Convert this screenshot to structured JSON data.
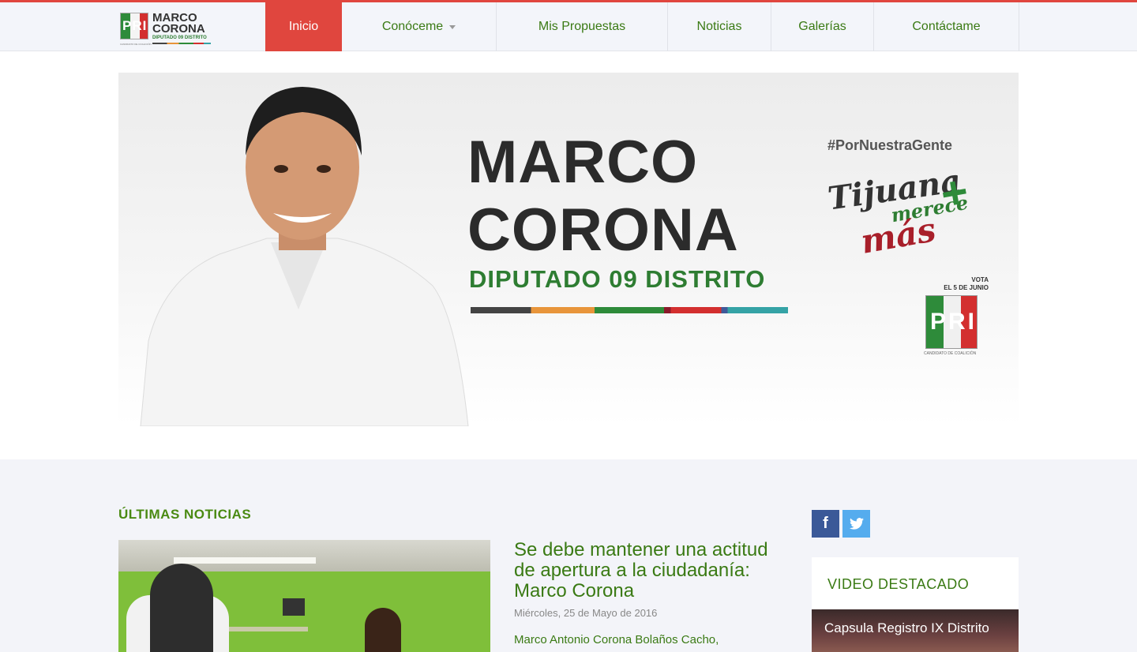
{
  "brand": {
    "logo_letters": "PRI",
    "name_line1": "MARCO",
    "name_line2": "CORONA",
    "subtitle": "DIPUTADO 09 DISTRITO",
    "tiny_caption": "CANDIDATO DE COALICIÓN"
  },
  "nav": {
    "items": [
      {
        "label": "Inicio",
        "active": true
      },
      {
        "label": "Conóceme",
        "has_dropdown": true
      },
      {
        "label": "Mis Propuestas"
      },
      {
        "label": "Noticias"
      },
      {
        "label": "Galerías"
      },
      {
        "label": "Contáctame"
      }
    ]
  },
  "hero": {
    "title_line1": "MARCO",
    "title_line2": "CORONA",
    "subtitle": "DIPUTADO 09 DISTRITO",
    "hashtag": "#PorNuestraGente",
    "slogan_word1": "Tijuana",
    "slogan_word2": "merece",
    "slogan_word3": "más",
    "slogan_plus": "+",
    "vote_line1": "VOTA",
    "vote_line2": "EL 5 DE JUNIO",
    "party_letters": "PRI",
    "party_caption": "CANDIDATO DE COALICIÓN"
  },
  "news": {
    "section_title": "ÚLTIMAS NOTICIAS",
    "title": "Se debe mantener una actitud de apertura a la ciudadanía: Marco Corona",
    "date": "Miércoles, 25 de Mayo de 2016",
    "excerpt": "Marco Antonio Corona Bolaños Cacho,"
  },
  "social": {
    "facebook_glyph": "f",
    "twitter_glyph": "🐦"
  },
  "video": {
    "section_title": "VIDEO DESTACADO",
    "caption": "Capsula Registro IX Distrito"
  },
  "colors": {
    "accent_red": "#e0463e",
    "brand_green": "#3a7a14",
    "facebook": "#3b5998",
    "twitter": "#55acee"
  }
}
